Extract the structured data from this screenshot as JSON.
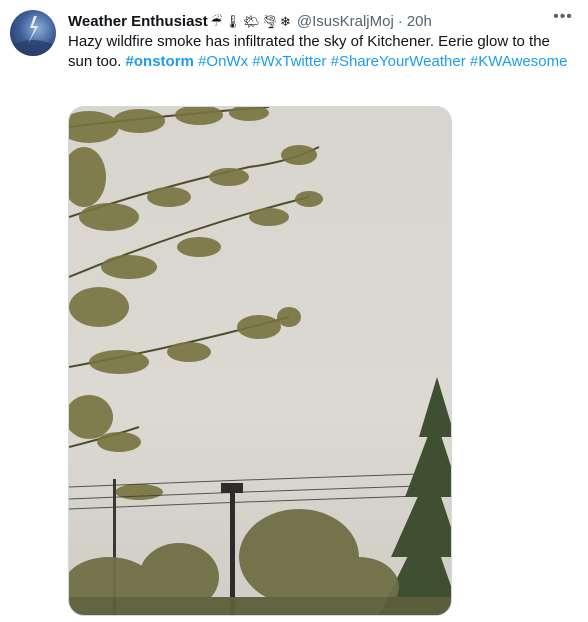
{
  "user": {
    "display_name": "Weather Enthusiast",
    "emojis": [
      "☔",
      "🌡",
      "🌤",
      "🌪",
      "❄"
    ],
    "handle": "@IsusKraljMoj",
    "separator": "·",
    "time": "20h"
  },
  "tweet": {
    "text": "Hazy wildfire smoke has infiltrated the sky of Kitchener. Eerie glow to the sun too.",
    "hashtags": [
      {
        "text": "#onstorm",
        "bold": true
      },
      {
        "text": "#OnWx",
        "bold": false
      },
      {
        "text": "#WxTwitter",
        "bold": false
      },
      {
        "text": "#ShareYourWeather",
        "bold": false
      },
      {
        "text": "#KWAwesome",
        "bold": false
      }
    ]
  },
  "menu": {
    "more_label": "•••"
  },
  "colors": {
    "link": "#1d9bf0",
    "secondary_text": "#536471",
    "sky": "#dbd7d1"
  },
  "media": {
    "kind": "photo",
    "subject": "hazy smoky sky with tree branches, power lines, light post"
  }
}
